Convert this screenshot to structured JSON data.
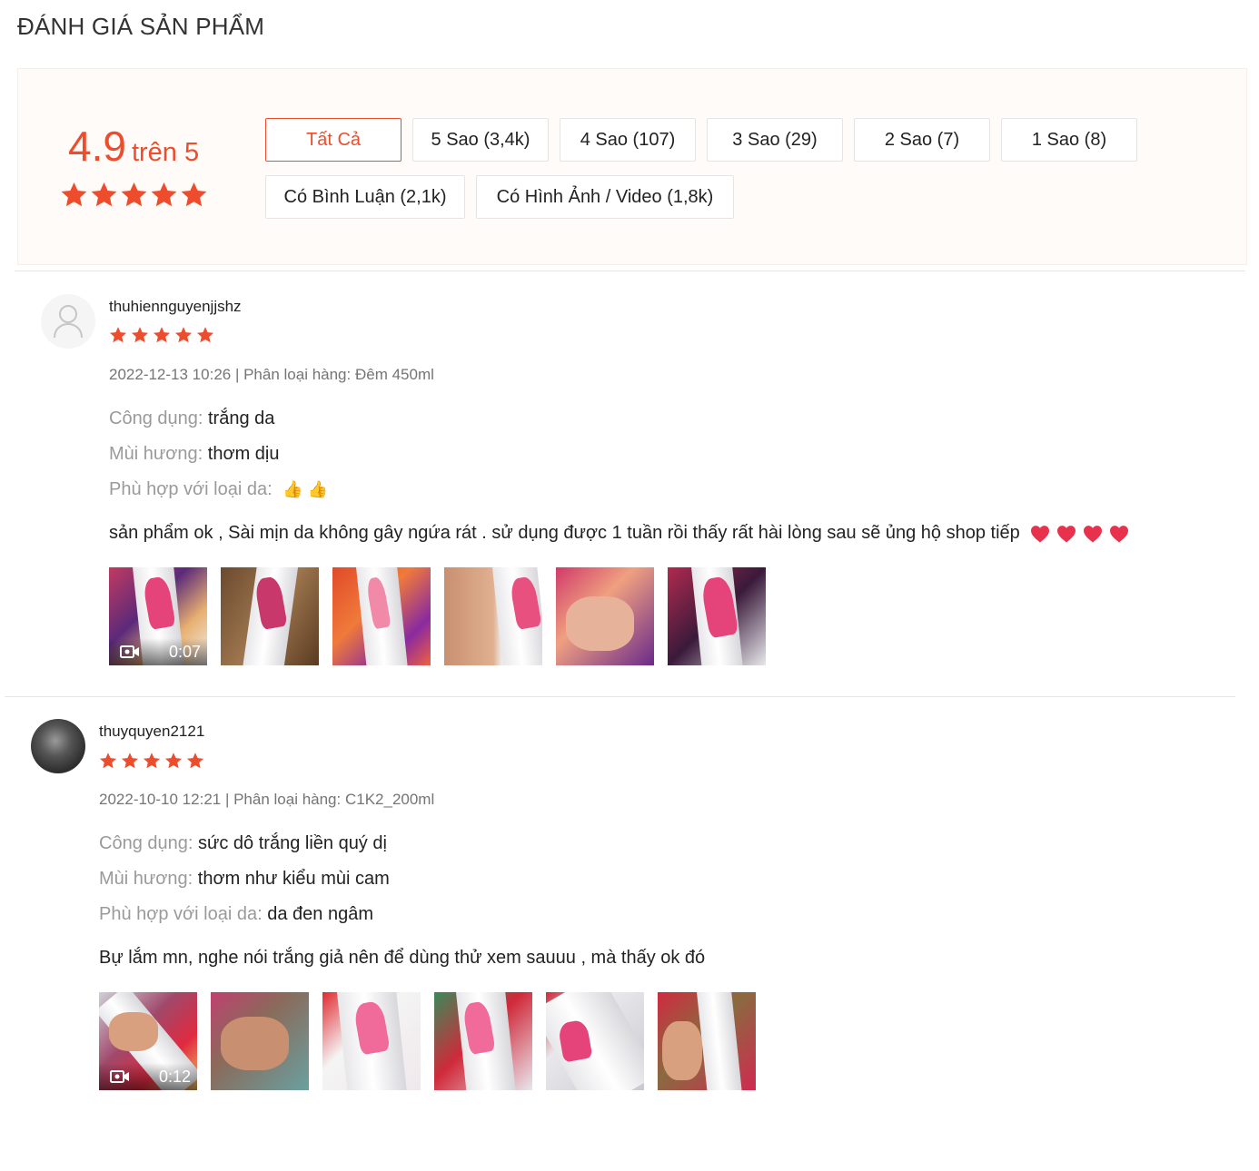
{
  "heading": "ĐÁNH GIÁ SẢN PHẨM",
  "summary": {
    "score": "4.9",
    "score_suffix": "trên 5",
    "rating": 4.9,
    "max_rating": 5
  },
  "filters": [
    {
      "label": "Tất Cả",
      "active": true
    },
    {
      "label": "5 Sao (3,4k)",
      "active": false
    },
    {
      "label": "4 Sao (107)",
      "active": false
    },
    {
      "label": "3 Sao (29)",
      "active": false
    },
    {
      "label": "2 Sao (7)",
      "active": false
    },
    {
      "label": "1 Sao (8)",
      "active": false
    },
    {
      "label": "Có Bình Luận (2,1k)",
      "active": false
    },
    {
      "label": "Có Hình Ảnh / Video (1,8k)",
      "active": false
    }
  ],
  "colors": {
    "accent": "#ee4d2d",
    "summary_bg": "#fffbf8",
    "muted_label": "#9a9a9a",
    "meta_text": "#757575",
    "heart": "#e8324d"
  },
  "reviews": [
    {
      "username": "thuhiennguyenjjshz",
      "stars": 5,
      "meta": "2022-12-13 10:26 | Phân loại hàng: Đêm 450ml",
      "attrs": [
        {
          "label": "Công dụng:",
          "value": "trắng da"
        },
        {
          "label": "Mùi hương:",
          "value": "thơm dịu"
        },
        {
          "label": "Phù hợp với loại da:",
          "value": "👍 👍"
        }
      ],
      "comment": "sản phẩm ok , Sài mịn da không gây ngứa rát . sử dụng được 1 tuần rồi thấy rất hài lòng sau sẽ ủng hộ shop tiếp",
      "heart_count": 4,
      "media": {
        "video_duration": "0:07",
        "photo_count": 6
      }
    },
    {
      "username": "thuyquyen2121",
      "stars": 5,
      "meta": "2022-10-10 12:21 | Phân loại hàng: C1K2_200ml",
      "attrs": [
        {
          "label": "Công dụng:",
          "value": "sức dô trắng liền quý dị"
        },
        {
          "label": "Mùi hương:",
          "value": "thơm như kiểu mùi cam"
        },
        {
          "label": "Phù hợp với loại da:",
          "value": "da đen ngâm"
        }
      ],
      "comment": "Bự lắm mn, nghe nói trắng giả nên để dùng thử xem sauuu , mà thấy ok đó",
      "heart_count": 0,
      "media": {
        "video_duration": "0:12",
        "photo_count": 6
      }
    }
  ]
}
